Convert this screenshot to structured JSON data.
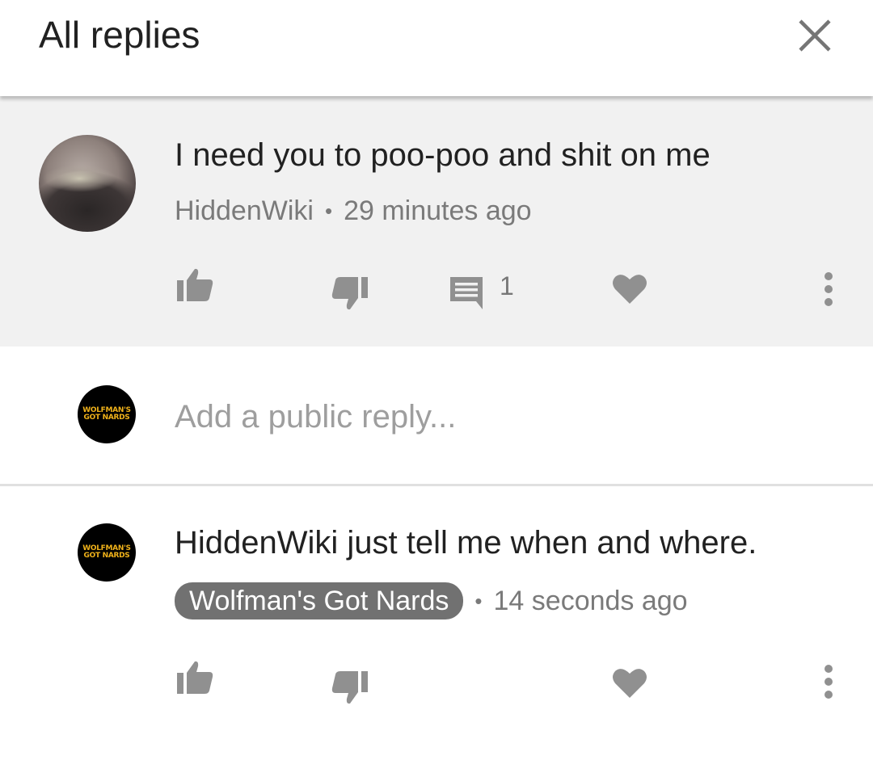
{
  "header": {
    "title": "All replies",
    "close_icon": "close-icon"
  },
  "parent_comment": {
    "text": "I need you to poo-poo and shit on me",
    "author": "HiddenWiki",
    "separator": "•",
    "time": "29 minutes ago",
    "reply_count": "1",
    "icons": [
      "thumb-up-icon",
      "thumb-down-icon",
      "reply-icon",
      "heart-icon",
      "more-vert-icon"
    ]
  },
  "reply_box": {
    "placeholder": "Add a public reply...",
    "avatar_line1": "WOLFMAN'S",
    "avatar_line2": "GOT NARDS"
  },
  "reply": {
    "text": "HiddenWiki just tell me when and where.",
    "author": "Wolfman's Got Nards",
    "separator": "•",
    "time": "14 seconds ago",
    "avatar_line1": "WOLFMAN'S",
    "avatar_line2": "GOT NARDS",
    "icons": [
      "thumb-up-icon",
      "thumb-down-icon",
      "heart-icon",
      "more-vert-icon"
    ]
  },
  "colors": {
    "parent_background": "#f1f1f1",
    "icon_gray": "#909090",
    "author_chip": "#717171",
    "avatar_text": "#f0b21a"
  }
}
